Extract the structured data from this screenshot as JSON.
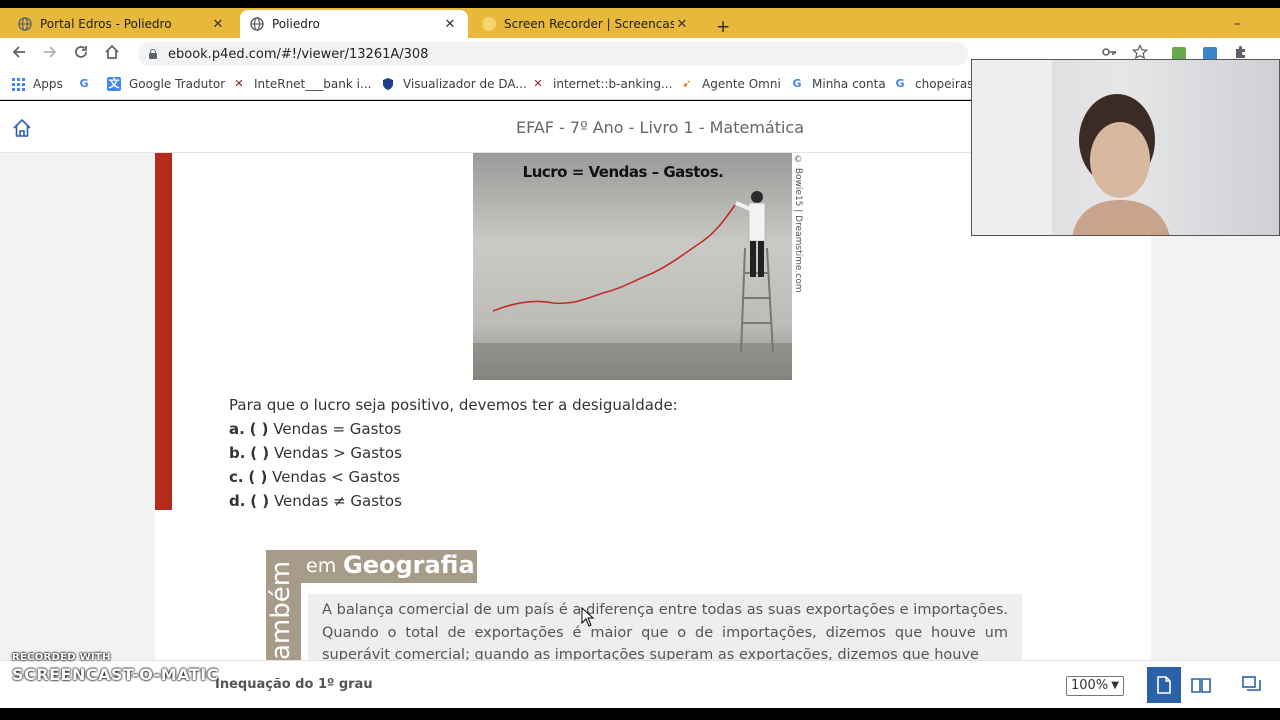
{
  "browser": {
    "tabs": [
      {
        "title": "Portal Edros - Poliedro",
        "active": false
      },
      {
        "title": "Poliedro",
        "active": true
      },
      {
        "title": "Screen Recorder | Screencast-O-",
        "active": false
      }
    ],
    "url": "ebook.p4ed.com/#!/viewer/13261A/308",
    "bookmarks": [
      {
        "label": "Apps",
        "icon": "apps-grid-icon"
      },
      {
        "label": "",
        "icon": "google-icon"
      },
      {
        "label": "Google Tradutor",
        "icon": "translate-icon"
      },
      {
        "label": "InteRnet___bank i...",
        "icon": "x-bookmark-icon"
      },
      {
        "label": "Visualizador de DA...",
        "icon": "shield-icon"
      },
      {
        "label": "internet::b-anking...",
        "icon": "x-bookmark-icon"
      },
      {
        "label": "Agente Omni",
        "icon": "omni-icon"
      },
      {
        "label": "Minha conta",
        "icon": "google-icon"
      },
      {
        "label": "chopeiras e",
        "icon": "google-icon"
      }
    ]
  },
  "app": {
    "title": "EFAF - 7º Ano - Livro 1 - Matemática"
  },
  "page": {
    "figure_title": "Lucro = Vendas – Gastos.",
    "figure_credit": "© Bowie15 | Dreamstime.com",
    "question": "Para que o lucro seja positivo, devemos ter a desigualdade:",
    "options": [
      {
        "letter": "a.",
        "paren": "(   )",
        "text": "Vendas = Gastos"
      },
      {
        "letter": "b.",
        "paren": "(   )",
        "text": "Vendas > Gastos"
      },
      {
        "letter": "c.",
        "paren": "(   )",
        "text": "Vendas < Gastos"
      },
      {
        "letter": "d.",
        "paren": "(   )",
        "text": "Vendas ≠ Gastos"
      }
    ],
    "tag_vertical": "ambém",
    "tag_em": "em",
    "tag_subject": "Geografia",
    "box_text": "A balança comercial de um país é a diferença entre todas as suas exportações e importações. Quando o total de exportações é maior que o de importações, dizemos que houve um superávit comercial; quando as importações superam as exportações, dizemos que houve"
  },
  "bottom": {
    "chapter": "Inequação do 1º grau",
    "zoom": "100%"
  },
  "watermark": {
    "top": "RECORDED WITH",
    "main": "SCREENCAST-O-MATIC"
  },
  "colors": {
    "accent_red": "#b42b1e",
    "tab_strip": "#e8b83a",
    "view_active": "#2a61a8",
    "tag_brown": "#a79c89"
  }
}
